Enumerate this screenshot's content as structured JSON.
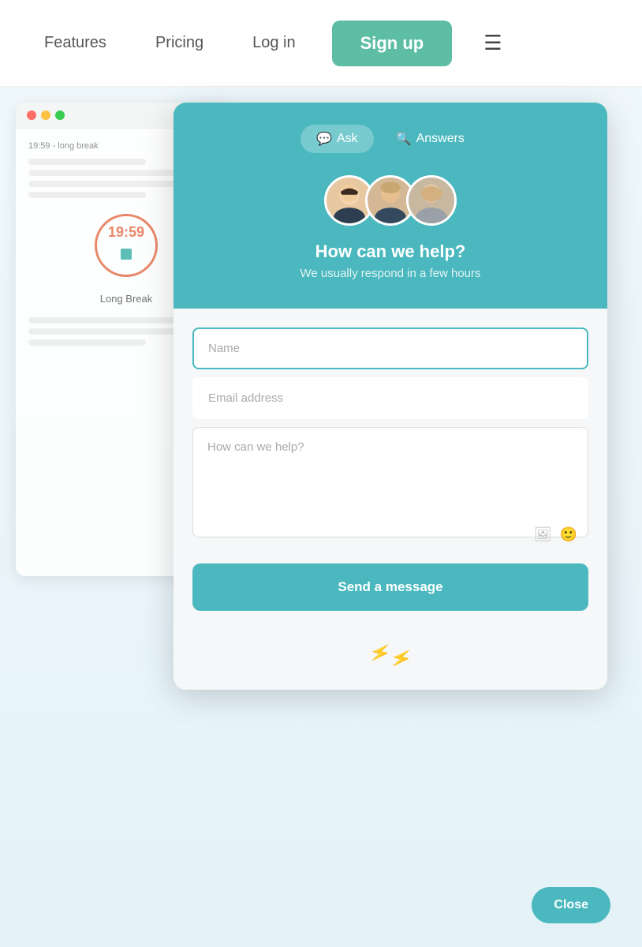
{
  "navbar": {
    "features_label": "Features",
    "pricing_label": "Pricing",
    "login_label": "Log in",
    "signup_label": "Sign up",
    "hamburger_label": "☰"
  },
  "chat_widget": {
    "tab_ask_label": "Ask",
    "tab_answers_label": "Answers",
    "title": "How can we help?",
    "subtitle": "We usually respond in a few hours",
    "name_placeholder": "Name",
    "email_placeholder": "Email address",
    "message_placeholder": "How can we help?",
    "send_button_label": "Send a message",
    "close_button_label": "Close"
  },
  "mockup": {
    "timer": "19:59",
    "break_label": "Long Break"
  }
}
